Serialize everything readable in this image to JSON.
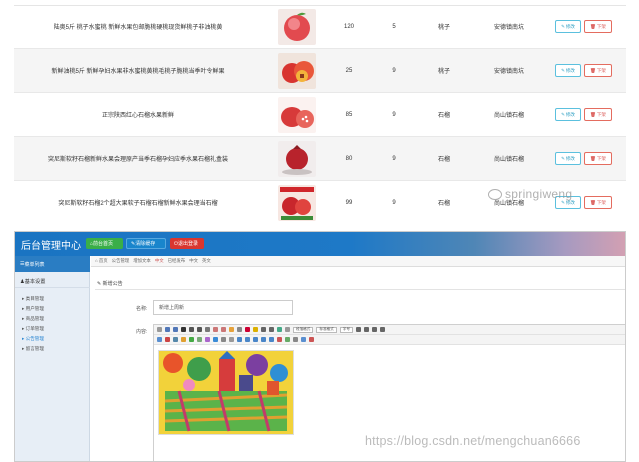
{
  "products": [
    {
      "name": "陆奥5斤 桃子水蜜桃 新鲜水果包邮脆桃硬桃现货鲜桃子非油桃黄",
      "price": "120",
      "stock": "5",
      "type": "桃子",
      "origin": "安德镇南坑",
      "row_shaded": false
    },
    {
      "name": "新鲜油桃5斤 新鲜孕妇水果非水蜜桃黄桃毛桃子脆桃当季叶令鲜果",
      "price": "25",
      "stock": "9",
      "type": "桃子",
      "origin": "安德镇南坑",
      "row_shaded": true
    },
    {
      "name": "正宗陕西红心石榴水果新鲜",
      "price": "85",
      "stock": "9",
      "type": "石榴",
      "origin": "尚山镇石榴",
      "row_shaded": false
    },
    {
      "name": "突尼斯软籽石榴新鲜水果会理原产当季石榴孕妇应季水果石榴礼盒装",
      "price": "80",
      "stock": "9",
      "type": "石榴",
      "origin": "尚山镇石榴",
      "row_shaded": true
    },
    {
      "name": "突尼斯软籽石榴2个超大果软子石榴石榴新鲜水果会理当石榴",
      "price": "99",
      "stock": "9",
      "type": "石榴",
      "origin": "尚山镇石榴",
      "row_shaded": false
    }
  ],
  "row_buttons": {
    "edit": "修改",
    "off_shelf": "下架"
  },
  "watermark_top": "springiweng",
  "admin": {
    "brand": "后台管理中心",
    "top_buttons": {
      "home": "前台首页",
      "clear_cache": "清除缓存",
      "logout": "退出登录"
    },
    "sidebar": {
      "header": "菜单列表",
      "group": "基本设置",
      "items": [
        "类目管理",
        "用户管理",
        "商品管理",
        "订单管理",
        "公告管理",
        "留言管理"
      ],
      "active_index": 4
    },
    "breadcrumbs": [
      "首页",
      "公告管理",
      "增加文本",
      "中文",
      "已经发布",
      "中文",
      "英文"
    ],
    "breadcrumb_current_index": 3,
    "section_title": "新增公告",
    "name_label": "名称:",
    "name_value": "新增上周新",
    "content_label": "内容:",
    "toolbar_selects": [
      "段落格式",
      "标准格式",
      "字号"
    ]
  },
  "watermark_bottom": "https://blog.csdn.net/mengchuan6666",
  "colors": {
    "accent_blue": "#1e79c7",
    "green_button": "#3aae48",
    "red_button": "#d9362f",
    "edit_border": "#5bc0de",
    "off_border": "#e46c5f"
  }
}
